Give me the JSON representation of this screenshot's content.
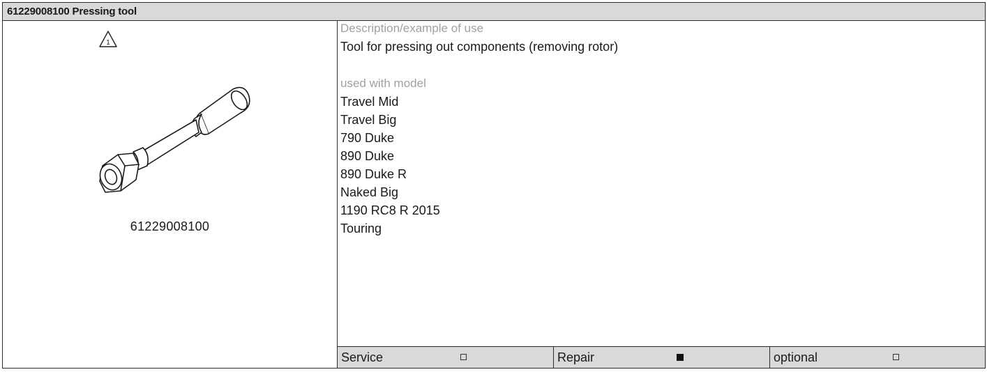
{
  "title": "61229008100 Pressing tool",
  "part_number": "61229008100",
  "icons": {
    "warning": "warning-triangle-1-icon",
    "tool": "pressing-tool-drawing"
  },
  "description_label": "Description/example of use",
  "description_text": "Tool for pressing out components (removing rotor)",
  "models_label": "used with model",
  "models": [
    "Travel Mid",
    "Travel Big",
    "790 Duke",
    "890 Duke",
    "890 Duke R",
    "Naked Big",
    "1190 RC8 R 2015",
    "Touring"
  ],
  "footer": [
    {
      "label": "Service",
      "checked": false
    },
    {
      "label": "Repair",
      "checked": true
    },
    {
      "label": "optional",
      "checked": false
    }
  ],
  "colors": {
    "header_bg": "#d9d9d9",
    "muted_text": "#a0a0a0",
    "border": "#2b2b2b"
  }
}
